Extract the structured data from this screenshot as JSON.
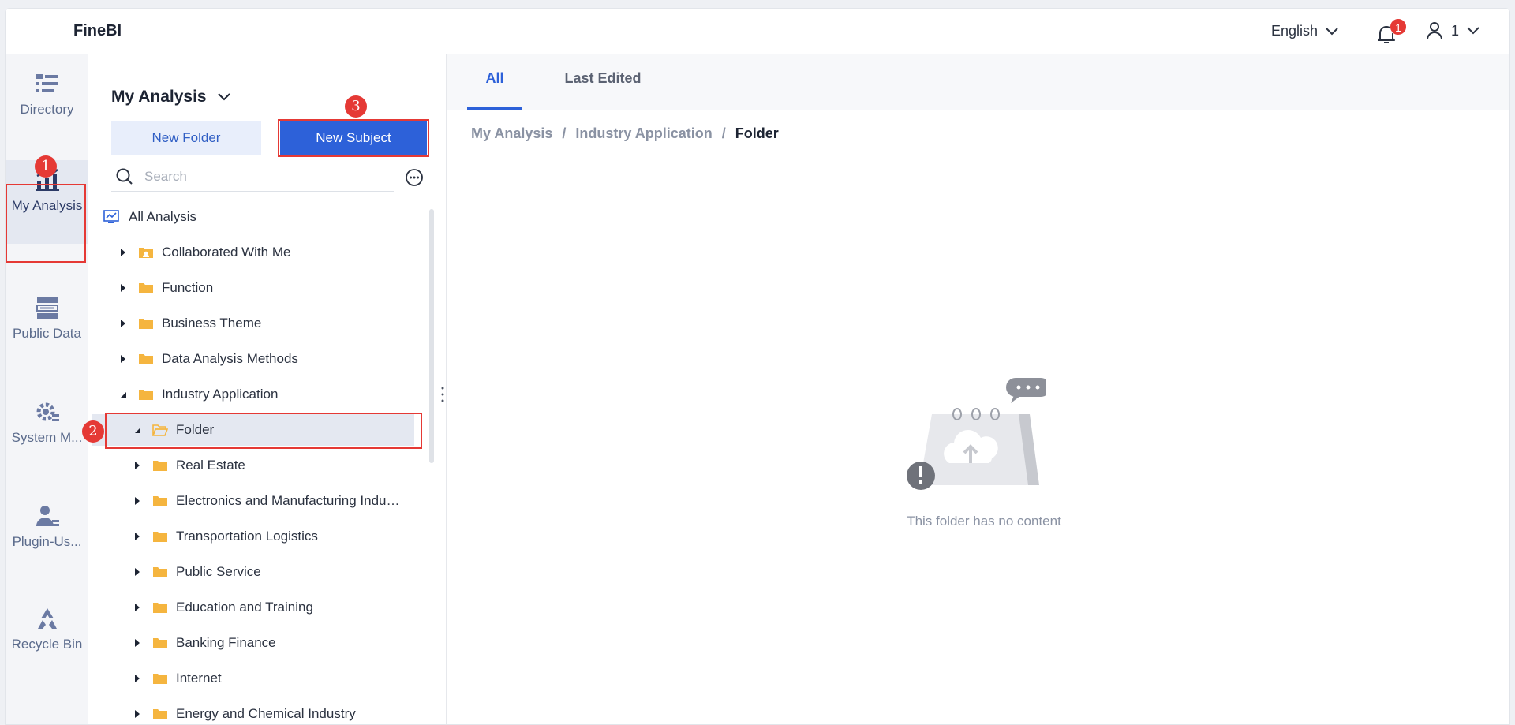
{
  "app": {
    "title": "FineBI"
  },
  "topbar": {
    "language": "English",
    "notification_count": "1",
    "user_name": "1"
  },
  "leftnav": {
    "items": [
      {
        "label": "Directory",
        "icon": "directory-icon"
      },
      {
        "label": "My Analysis",
        "icon": "chart-icon"
      },
      {
        "label": "Public Data",
        "icon": "database-icon"
      },
      {
        "label": "System M...",
        "icon": "gear-icon"
      },
      {
        "label": "Plugin-Us...",
        "icon": "user-settings-icon"
      },
      {
        "label": "Recycle Bin",
        "icon": "recycle-icon"
      }
    ]
  },
  "annotations": {
    "step1": "1",
    "step2": "2",
    "step3": "3"
  },
  "tree_panel": {
    "title": "My Analysis",
    "new_folder": "New Folder",
    "new_subject": "New Subject",
    "search_placeholder": "Search",
    "items": [
      {
        "label": "All Analysis"
      },
      {
        "label": "Collaborated With Me"
      },
      {
        "label": "Function"
      },
      {
        "label": "Business Theme"
      },
      {
        "label": "Data Analysis Methods"
      },
      {
        "label": "Industry Application"
      },
      {
        "label": "Folder"
      },
      {
        "label": "Real Estate"
      },
      {
        "label": "Electronics and Manufacturing Industry"
      },
      {
        "label": "Transportation Logistics"
      },
      {
        "label": "Public Service"
      },
      {
        "label": "Education and Training"
      },
      {
        "label": "Banking Finance"
      },
      {
        "label": "Internet"
      },
      {
        "label": "Energy and Chemical Industry"
      }
    ]
  },
  "main": {
    "tabs": [
      {
        "label": "All"
      },
      {
        "label": "Last Edited"
      }
    ],
    "breadcrumb": [
      "My Analysis",
      "Industry Application",
      "Folder"
    ],
    "breadcrumb_sep": "/",
    "empty_text": "This folder has no content"
  },
  "colors": {
    "accent": "#2d61d9",
    "annotation_red": "#e53935",
    "folder": "#f5b53f"
  }
}
